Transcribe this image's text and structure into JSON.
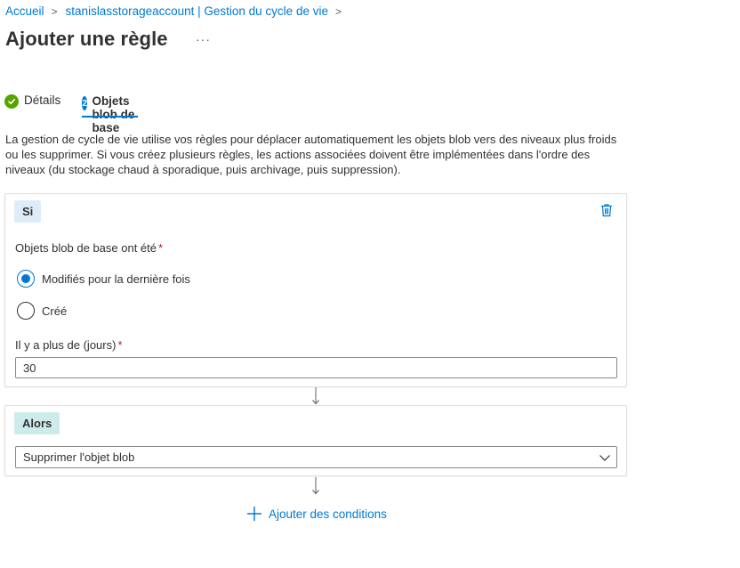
{
  "breadcrumb": {
    "items": [
      "Accueil",
      "stanislasstorageaccount | Gestion du cycle de vie"
    ],
    "separator": ">"
  },
  "page": {
    "title": "Ajouter une règle",
    "more_label": "···"
  },
  "tabs": [
    {
      "label": "Détails",
      "status": "completed",
      "icon": "check-icon"
    },
    {
      "label": "Objets blob de base",
      "step": "2",
      "status": "active"
    }
  ],
  "description": "La gestion de cycle de vie utilise vos règles pour déplacer automatiquement les objets blob vers des niveaux plus froids ou les supprimer. Si vous créez plusieurs règles, les actions associées doivent être implémentées dans l'ordre des niveaux (du stockage chaud à sporadique, puis archivage, puis suppression).",
  "if_card": {
    "badge": "Si",
    "condition_label": "Objets blob de base ont été",
    "required_mark": "*",
    "options": [
      {
        "label": "Modifiés pour la dernière fois",
        "checked": true
      },
      {
        "label": "Créé",
        "checked": false
      }
    ],
    "days_label": "Il y a plus de (jours)",
    "days_value": "30",
    "delete_icon": "trash-icon"
  },
  "then_card": {
    "badge": "Alors",
    "action_selected": "Supprimer l'objet blob"
  },
  "add_conditions_label": "Ajouter des conditions",
  "colors": {
    "accent": "#0078d4",
    "success": "#57a300",
    "if_badge_bg": "#deecf9",
    "then_badge_bg": "#cdebeb",
    "required": "#a4262c"
  }
}
